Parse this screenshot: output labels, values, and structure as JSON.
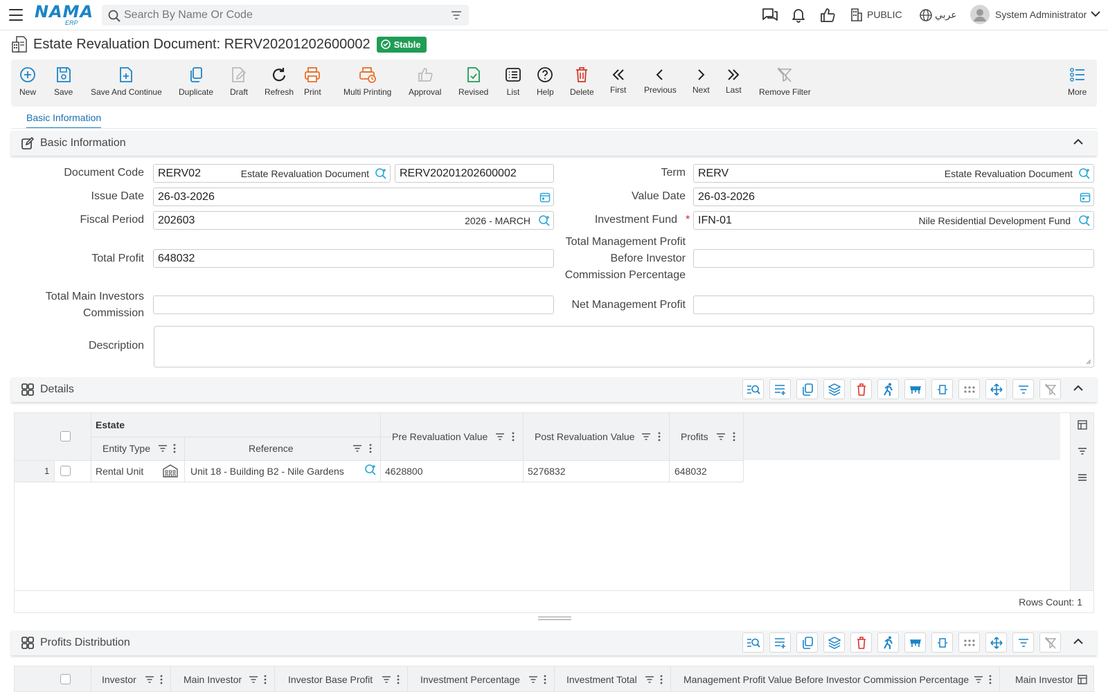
{
  "app": {
    "logo_text": "NAMA",
    "logo_sub": "ERP",
    "search_placeholder": "Search By Name Or Code",
    "branch": "PUBLIC",
    "language": "عربي",
    "user": "System Administrator"
  },
  "page": {
    "title": "Estate Revaluation Document: RERV20201202600002",
    "status": "Stable",
    "status_color": "#1f9d55"
  },
  "toolbar": {
    "new": "New",
    "save": "Save",
    "save_continue": "Save And Continue",
    "duplicate": "Duplicate",
    "draft": "Draft",
    "refresh": "Refresh",
    "print": "Print",
    "multi_printing": "Multi Printing",
    "approval": "Approval",
    "revised": "Revised",
    "list": "List",
    "help": "Help",
    "delete": "Delete",
    "first": "First",
    "previous": "Previous",
    "next": "Next",
    "last": "Last",
    "remove_filter": "Remove Filter",
    "more": "More"
  },
  "tabs": [
    "Basic Information"
  ],
  "basic_info": {
    "section_title": "Basic Information",
    "document_code_label": "Document Code",
    "document_code": "RERV02",
    "document_code_desc": "Estate Revaluation Document",
    "document_number": "RERV20201202600002",
    "term_label": "Term",
    "term": "RERV",
    "term_desc": "Estate Revaluation Document",
    "issue_date_label": "Issue Date",
    "issue_date": "26-03-2026",
    "value_date_label": "Value Date",
    "value_date": "26-03-2026",
    "fiscal_period_label": "Fiscal Period",
    "fiscal_period": "202603",
    "fiscal_period_desc": "2026 - MARCH",
    "investment_fund_label": "Investment Fund",
    "investment_fund": "IFN-01",
    "investment_fund_desc": "Nile Residential Development Fund",
    "total_profit_label": "Total Profit",
    "total_profit": "648032",
    "total_mgmt_profit_label_1": "Total Management Profit",
    "total_mgmt_profit_label_2": "Before Investor",
    "total_mgmt_profit_label_3": "Commission Percentage",
    "total_mgmt_profit": "",
    "total_main_investors_label_1": "Total Main Investors",
    "total_main_investors_label_2": "Commission",
    "total_main_investors": "",
    "net_mgmt_profit_label": "Net Management Profit",
    "net_mgmt_profit": "",
    "description_label": "Description",
    "description": ""
  },
  "details": {
    "section_title": "Details",
    "group_header": "Estate",
    "columns": {
      "entity_type": "Entity Type",
      "reference": "Reference",
      "pre_value": "Pre Revaluation Value",
      "post_value": "Post Revaluation Value",
      "profits": "Profits"
    },
    "rows": [
      {
        "num": "1",
        "entity_type": "Rental Unit",
        "reference": "Unit 18 - Building B2 - Nile Gardens",
        "pre_value": "4628800",
        "post_value": "5276832",
        "profits": "648032"
      }
    ],
    "rows_count": "Rows Count: 1"
  },
  "profits_distribution": {
    "section_title": "Profits Distribution",
    "columns": {
      "investor": "Investor",
      "main_investor": "Main Investor",
      "investor_base_profit": "Investor Base Profit",
      "investment_percentage": "Investment Percentage",
      "investment_total": "Investment Total",
      "mgmt_profit_value": "Management Profit Value Before Investor Commission Percentage",
      "main_investor_2": "Main Investor"
    }
  }
}
